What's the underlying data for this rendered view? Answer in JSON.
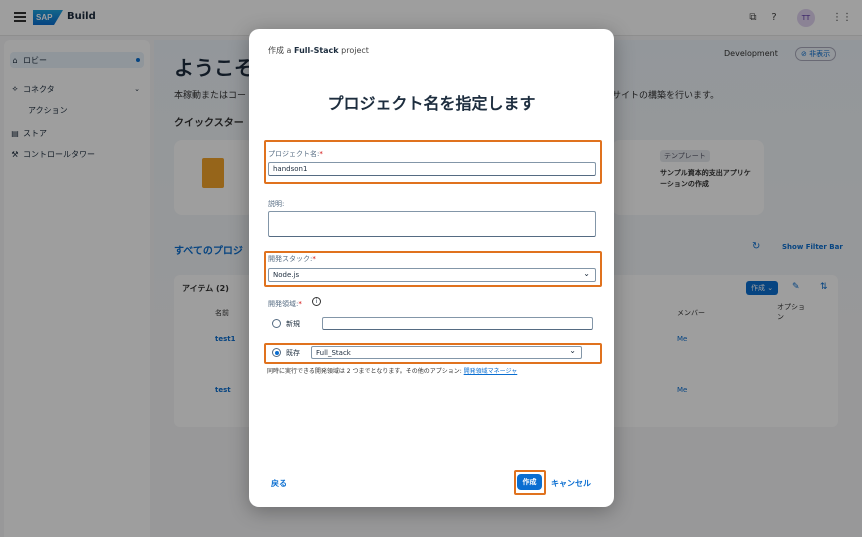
{
  "shell": {
    "logo": "SAP",
    "product": "Build",
    "avatar_initials": "TT"
  },
  "sidebar": {
    "items": [
      {
        "label": "ロビー",
        "icon": "home-icon"
      },
      {
        "label": "コネクタ",
        "icon": "connector-icon"
      },
      {
        "label": "アクション",
        "icon": ""
      },
      {
        "label": "ストア",
        "icon": "store-icon"
      },
      {
        "label": "コントロールタワー",
        "icon": "tools-icon"
      }
    ]
  },
  "background": {
    "welcome": "ようこそ",
    "desc_left": "本稼動またはコー",
    "desc_right": "サイトの構築を行います。",
    "quickstart": "クイックスター",
    "env": "Development",
    "hide": "非表示",
    "template_tag": "テンプレート",
    "template_title": "サンプル資本的支出アプリケーションの作成",
    "all_projects": "すべてのプロジ",
    "show_filter": "Show Filter Bar",
    "items_count": "アイテム (2)",
    "col_name": "名前",
    "col_member": "メンバー",
    "col_option": "オプション",
    "create_menu": "作成",
    "rows": [
      {
        "name": "test1",
        "member": "Me"
      },
      {
        "name": "test",
        "member": "Me"
      }
    ]
  },
  "dialog": {
    "subtitle_prefix": "作成 a ",
    "subtitle_bold": "Full-Stack",
    "subtitle_suffix": " project",
    "title": "プロジェクト名を指定します",
    "project_name_label": "プロジェクト名:",
    "project_name_value": "handson1",
    "description_label": "説明:",
    "description_value": "",
    "stack_label": "開発スタック:",
    "stack_value": "Node.js",
    "space_label": "開発領域:",
    "radio_new": "新規",
    "radio_existing": "既存",
    "existing_value": "Full_Stack",
    "note_text": "同時に実行できる開発領域は 2 つまでとなります。その他のアプション: ",
    "note_link": "開発領域マネージャ",
    "back": "戻る",
    "create": "作成",
    "cancel": "キャンセル"
  },
  "colors": {
    "accent": "#0a6ed1",
    "highlight": "#e0721e"
  }
}
